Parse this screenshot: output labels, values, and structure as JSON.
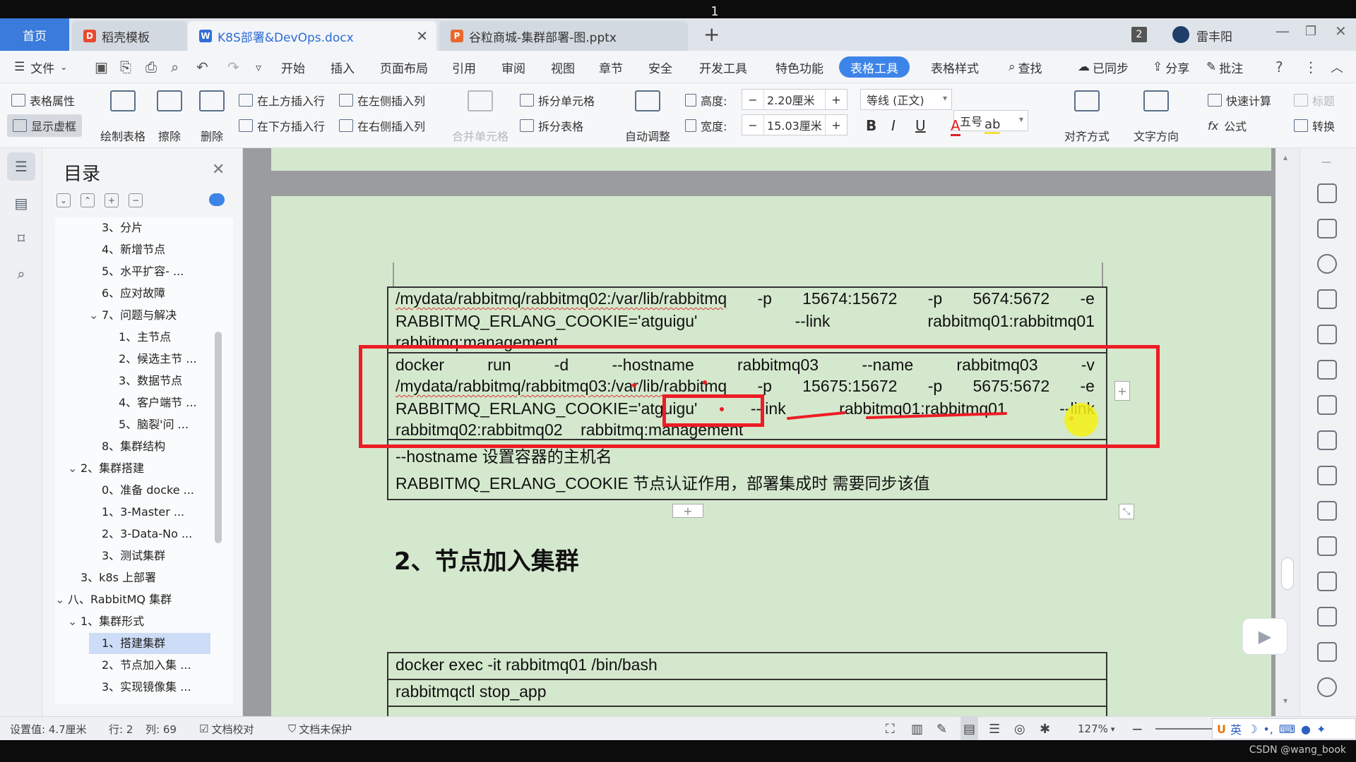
{
  "screen": {
    "top_number": "1",
    "watermark": "CSDN @wang_book"
  },
  "tabs": [
    {
      "label": "首页"
    },
    {
      "label": "稻壳模板",
      "icon": "docer-icon"
    },
    {
      "label": "K8S部署&DevOps.docx",
      "icon": "word-icon"
    },
    {
      "label": "谷粒商城-集群部署-图.pptx",
      "icon": "ppt-icon"
    }
  ],
  "window": {
    "badge": "2",
    "user": "雷丰阳"
  },
  "menu": [
    "文件",
    "开始",
    "插入",
    "页面布局",
    "引用",
    "审阅",
    "视图",
    "章节",
    "安全",
    "开发工具",
    "特色功能",
    "表格工具",
    "表格样式",
    "查找",
    "已同步",
    "分享",
    "批注"
  ],
  "ribbon": {
    "table_props": "表格属性",
    "show_borders": "显示虚框",
    "draw_table": "绘制表格",
    "erase": "擦除",
    "delete": "删除",
    "insert_row_above": "在上方插入行",
    "insert_row_below": "在下方插入行",
    "insert_col_left": "在左侧插入列",
    "insert_col_right": "在右侧插入列",
    "merge_cells": "合并单元格",
    "split_cells": "拆分单元格",
    "split_table": "拆分表格",
    "auto_adjust": "自动调整",
    "height_label": "高度:",
    "height_value": "2.20厘米",
    "width_label": "宽度:",
    "width_value": "15.03厘米",
    "font_name": "等线 (正文)",
    "font_size": "五号",
    "bold": "B",
    "italic": "I",
    "underline": "U",
    "font_color": "A",
    "align": "对齐方式",
    "text_direction": "文字方向",
    "quick_calc": "快速计算",
    "formula": "公式",
    "title_row": "标题",
    "convert": "转换"
  },
  "toc": {
    "title": "目录",
    "items": [
      {
        "label": "3、分片",
        "indent": 3,
        "arrow": ""
      },
      {
        "label": "4、新增节点",
        "indent": 3,
        "arrow": ""
      },
      {
        "label": "5、水平扩容- ...",
        "indent": 3,
        "arrow": ""
      },
      {
        "label": "6、应对故障",
        "indent": 3,
        "arrow": ""
      },
      {
        "label": "7、问题与解决",
        "indent": 3,
        "arrow": "v"
      },
      {
        "label": "1、主节点",
        "indent": 4,
        "arrow": ""
      },
      {
        "label": "2、候选主节 ...",
        "indent": 4,
        "arrow": ""
      },
      {
        "label": "3、数据节点",
        "indent": 4,
        "arrow": ""
      },
      {
        "label": "4、客户端节 ...",
        "indent": 4,
        "arrow": ""
      },
      {
        "label": "5、脑裂'问 ...",
        "indent": 4,
        "arrow": ""
      },
      {
        "label": "8、集群结构",
        "indent": 3,
        "arrow": ""
      },
      {
        "label": "2、集群搭建",
        "indent": 2,
        "arrow": "v"
      },
      {
        "label": "0、准备 docke ...",
        "indent": 3,
        "arrow": ""
      },
      {
        "label": "1、3-Master ...",
        "indent": 3,
        "arrow": ""
      },
      {
        "label": "2、3-Data-No ...",
        "indent": 3,
        "arrow": ""
      },
      {
        "label": "3、测试集群",
        "indent": 3,
        "arrow": ""
      },
      {
        "label": "3、k8s 上部署",
        "indent": 2,
        "arrow": ""
      },
      {
        "label": "八、RabbitMQ 集群",
        "indent": 1,
        "arrow": "v"
      },
      {
        "label": "1、集群形式",
        "indent": 2,
        "arrow": "v"
      },
      {
        "label": "1、搭建集群",
        "indent": 3,
        "arrow": "",
        "selected": true
      },
      {
        "label": "2、节点加入集 ...",
        "indent": 3,
        "arrow": ""
      },
      {
        "label": "3、实现镜像集 ...",
        "indent": 3,
        "arrow": ""
      }
    ]
  },
  "doc": {
    "row1": {
      "line1": [
        "/mydata/rabbitmq/rabbitmq02:/var/lib/rabbitmq",
        "-p",
        "15674:15672",
        "-p",
        "5674:5672",
        "-e"
      ],
      "line2": [
        "RABBITMQ_ERLANG_COOKIE='atguigu'",
        "--link",
        "rabbitmq01:rabbitmq01"
      ],
      "line3": "rabbitmq:management"
    },
    "row2": {
      "line1": [
        "docker",
        "run",
        "-d",
        "--hostname",
        "rabbitmq03",
        "--name",
        "rabbitmq03",
        "-v"
      ],
      "line2": [
        "/mydata/rabbitmq/rabbitmq03:/var/lib/rabbitmq",
        "-p",
        "15675:15672",
        "-p",
        "5675:5672",
        "-e"
      ],
      "line3": [
        "RABBITMQ_ERLANG_COOKIE='atguigu'",
        "--link",
        "rabbitmq01:rabbitmq01",
        "--link"
      ],
      "line4": "rabbitmq02:rabbitmq02    rabbitmq:management"
    },
    "row3": {
      "line1": "--hostname 设置容器的主机名",
      "line2": "RABBITMQ_ERLANG_COOKIE 节点认证作用，部署集成时 需要同步该值"
    },
    "heading": "2、节点加入集群",
    "table2": {
      "row1": "docker exec -it rabbitmq01 /bin/bash",
      "row2": "rabbitmqctl stop_app"
    }
  },
  "status": {
    "setting": "设置值: 4.7厘米",
    "row": "行: 2",
    "col": "列: 69",
    "proofread": "文档校对",
    "protect": "文档未保护",
    "zoom": "127%",
    "ime": "英"
  },
  "colors": {
    "accent": "#3d84e8",
    "page_bg": "#d4e8cd",
    "annotation": "#ee1c25"
  }
}
